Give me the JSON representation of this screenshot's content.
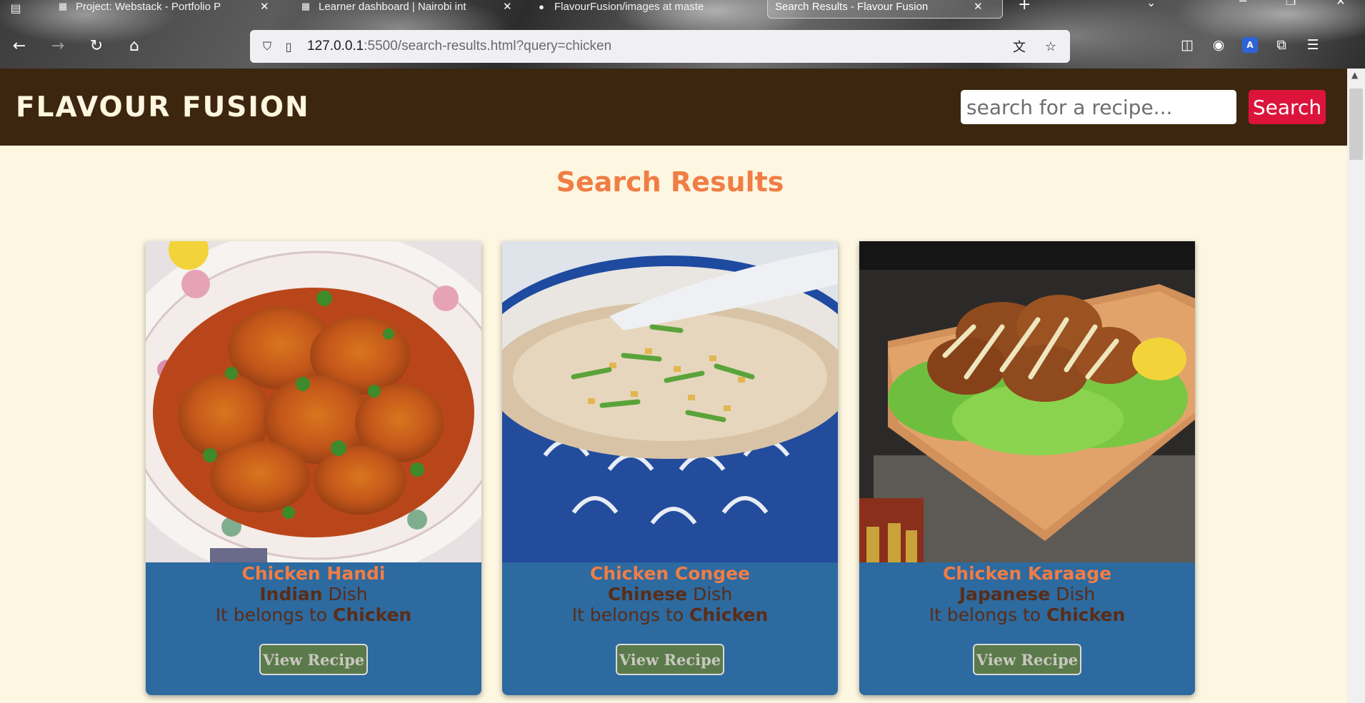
{
  "browser": {
    "tabs": [
      {
        "title": "Project: Webstack - Portfolio P",
        "favicon": "doc-icon",
        "active": false
      },
      {
        "title": "Learner dashboard | Nairobi int",
        "favicon": "alx-icon",
        "active": false
      },
      {
        "title": "FlavourFusion/images at maste",
        "favicon": "github-icon",
        "active": false
      },
      {
        "title": "Search Results - Flavour Fusion",
        "favicon": "",
        "active": true
      }
    ],
    "url_host": "127.0.0.1",
    "url_rest": ":5500/search-results.html?query=chicken"
  },
  "site": {
    "brand": "FLAVOUR FUSION",
    "search_placeholder": "search for a recipe...",
    "search_button": "Search",
    "results_title": "Search Results"
  },
  "results": [
    {
      "name": "Chicken Handi",
      "cuisine": "Indian",
      "dish_word": "Dish",
      "belongs_prefix": "It belongs to",
      "category": "Chicken",
      "button": "View Recipe"
    },
    {
      "name": "Chicken Congee",
      "cuisine": "Chinese",
      "dish_word": "Dish",
      "belongs_prefix": "It belongs to",
      "category": "Chicken",
      "button": "View Recipe"
    },
    {
      "name": "Chicken Karaage",
      "cuisine": "Japanese",
      "dish_word": "Dish",
      "belongs_prefix": "It belongs to",
      "category": "Chicken",
      "button": "View Recipe"
    }
  ],
  "colors": {
    "header_bg": "#3d260f",
    "page_bg": "#fdf6e0",
    "accent": "#f07d45",
    "card_bg": "#2c6aa0",
    "search_button": "#dc143c",
    "view_button": "#5b7a4b"
  }
}
